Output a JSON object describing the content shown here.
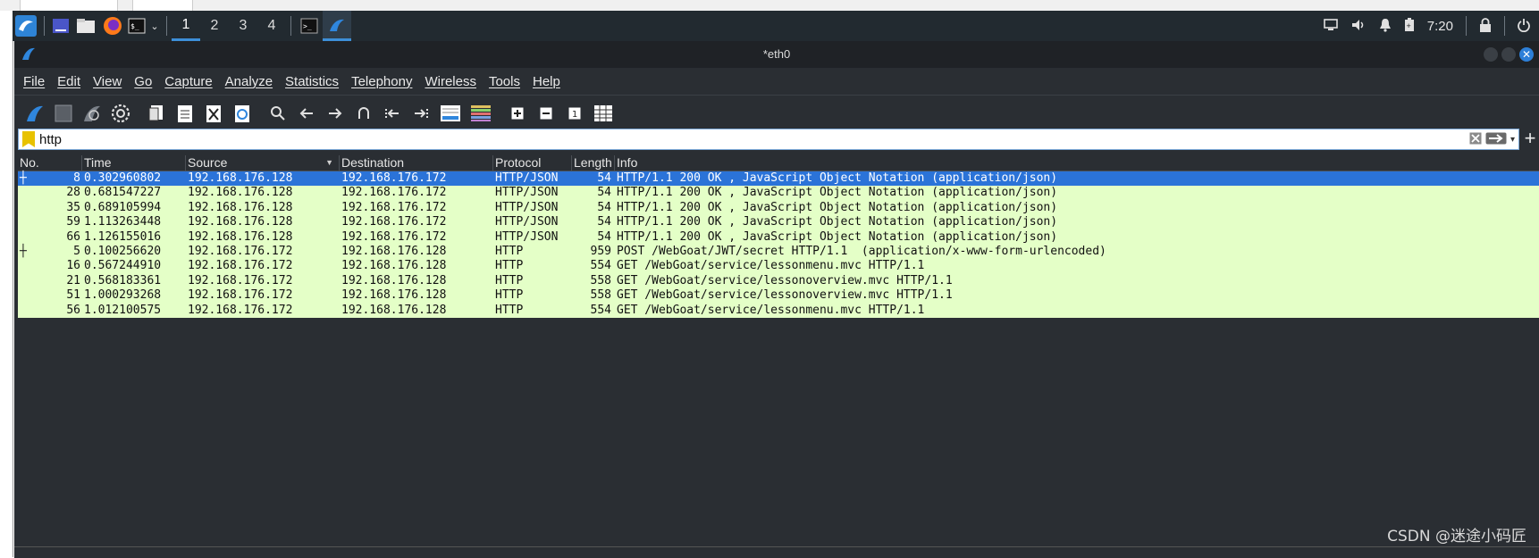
{
  "window": {
    "title": "*eth0"
  },
  "taskbar": {
    "workspaces": [
      "1",
      "2",
      "3",
      "4"
    ],
    "active_workspace": "1",
    "clock": "7:20",
    "icons": [
      "kali-menu-icon",
      "show-desktop-icon",
      "file-manager-icon",
      "firefox-icon",
      "terminal-icon",
      "chevron-down-icon",
      "terminal-window-icon",
      "wireshark-window-icon",
      "display-icon",
      "volume-icon",
      "bell-icon",
      "battery-icon",
      "lock-icon",
      "power-icon"
    ]
  },
  "menu": [
    "File",
    "Edit",
    "View",
    "Go",
    "Capture",
    "Analyze",
    "Statistics",
    "Telephony",
    "Wireless",
    "Tools",
    "Help"
  ],
  "filter": {
    "value": "http"
  },
  "columns": [
    "No.",
    "Time",
    "Source",
    "Destination",
    "Protocol",
    "Length",
    "Info"
  ],
  "packets": [
    {
      "no": "8",
      "time": "0.302960802",
      "src": "192.168.176.128",
      "dst": "192.168.176.172",
      "proto": "HTTP/JSON",
      "len": "54",
      "info": "HTTP/1.1 200 OK , JavaScript Object Notation (application/json)",
      "selected": true
    },
    {
      "no": "28",
      "time": "0.681547227",
      "src": "192.168.176.128",
      "dst": "192.168.176.172",
      "proto": "HTTP/JSON",
      "len": "54",
      "info": "HTTP/1.1 200 OK , JavaScript Object Notation (application/json)"
    },
    {
      "no": "35",
      "time": "0.689105994",
      "src": "192.168.176.128",
      "dst": "192.168.176.172",
      "proto": "HTTP/JSON",
      "len": "54",
      "info": "HTTP/1.1 200 OK , JavaScript Object Notation (application/json)"
    },
    {
      "no": "59",
      "time": "1.113263448",
      "src": "192.168.176.128",
      "dst": "192.168.176.172",
      "proto": "HTTP/JSON",
      "len": "54",
      "info": "HTTP/1.1 200 OK , JavaScript Object Notation (application/json)"
    },
    {
      "no": "66",
      "time": "1.126155016",
      "src": "192.168.176.128",
      "dst": "192.168.176.172",
      "proto": "HTTP/JSON",
      "len": "54",
      "info": "HTTP/1.1 200 OK , JavaScript Object Notation (application/json)"
    },
    {
      "no": "5",
      "time": "0.100256620",
      "src": "192.168.176.172",
      "dst": "192.168.176.128",
      "proto": "HTTP",
      "len": "959",
      "info": "POST /WebGoat/JWT/secret HTTP/1.1  (application/x-www-form-urlencoded)"
    },
    {
      "no": "16",
      "time": "0.567244910",
      "src": "192.168.176.172",
      "dst": "192.168.176.128",
      "proto": "HTTP",
      "len": "554",
      "info": "GET /WebGoat/service/lessonmenu.mvc HTTP/1.1"
    },
    {
      "no": "21",
      "time": "0.568183361",
      "src": "192.168.176.172",
      "dst": "192.168.176.128",
      "proto": "HTTP",
      "len": "558",
      "info": "GET /WebGoat/service/lessonoverview.mvc HTTP/1.1"
    },
    {
      "no": "51",
      "time": "1.000293268",
      "src": "192.168.176.172",
      "dst": "192.168.176.128",
      "proto": "HTTP",
      "len": "558",
      "info": "GET /WebGoat/service/lessonoverview.mvc HTTP/1.1"
    },
    {
      "no": "56",
      "time": "1.012100575",
      "src": "192.168.176.172",
      "dst": "192.168.176.128",
      "proto": "HTTP",
      "len": "554",
      "info": "GET /WebGoat/service/lessonmenu.mvc HTTP/1.1"
    }
  ],
  "watermark": "CSDN @迷途小码匠",
  "colors": {
    "selected_row": "#2b73d8",
    "http_row": "#e4ffc7",
    "taskbar": "#222a30",
    "window_bg": "#2a2e33"
  }
}
